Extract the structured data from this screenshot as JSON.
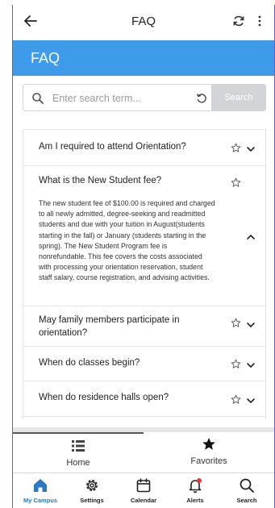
{
  "appbar": {
    "title": "FAQ"
  },
  "header": {
    "title": "FAQ"
  },
  "search": {
    "placeholder": "Enter search term...",
    "button_label": "Search"
  },
  "faq": [
    {
      "question": "Am I required to attend Orientation?",
      "expanded": false,
      "answer": ""
    },
    {
      "question": "What is the New Student fee?",
      "expanded": true,
      "answer": "The new student fee of $100.00 is required and charged to all newly admitted, degree-seeking and readmitted students and due with your tuition in August(students starting in the fall) or January (students starting in the spring). The New Student Program fee is nonrefundable. This fee covers the costs associated with processing your orientation reservation, student staff salary, course registration, and advising activities."
    },
    {
      "question": "May family members participate in orientation?",
      "expanded": false,
      "answer": ""
    },
    {
      "question": "When do classes begin?",
      "expanded": false,
      "answer": ""
    },
    {
      "question": "When do residence halls open?",
      "expanded": false,
      "answer": ""
    }
  ],
  "tabs": {
    "home": "Home",
    "favorites": "Favorites"
  },
  "nav": {
    "my_campus": "My Campus",
    "settings": "Settings",
    "calendar": "Calendar",
    "alerts": "Alerts",
    "search": "Search"
  },
  "colors": {
    "accent": "#3d9be9",
    "active_nav": "#2b79c2",
    "alert_dot": "#e53935"
  }
}
